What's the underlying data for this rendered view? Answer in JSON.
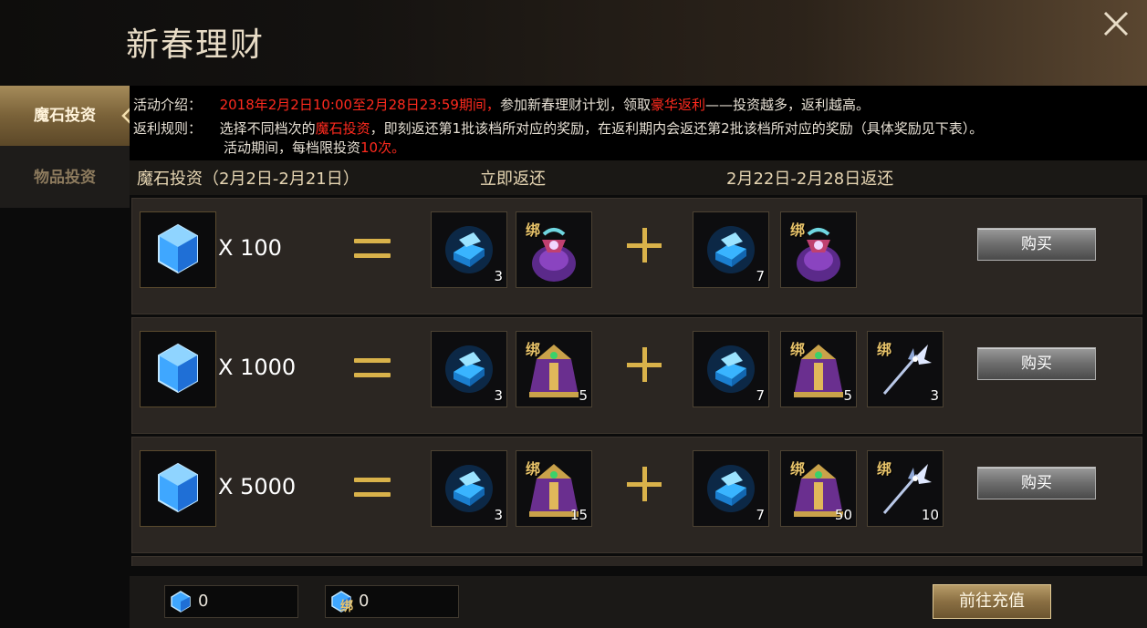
{
  "window": {
    "title": "新春理财"
  },
  "sidebar": {
    "items": [
      {
        "label": "魔石投资",
        "active": true
      },
      {
        "label": "物品投资",
        "active": false
      }
    ]
  },
  "info": {
    "intro_label": "活动介绍：",
    "intro_period": "2018年2月2日10:00至2月28日23:59期间，",
    "intro_text1": "参加新春理财计划，领取",
    "intro_highlight": "豪华返利",
    "intro_text2": "——投资越多，返利越高。",
    "rule_label": "返利规则：",
    "rule_text1": "选择不同档次的",
    "rule_highlight": "魔石投资",
    "rule_text2": "，即刻返还第1批该档所对应的奖励，在返利期内会返还第2批该档所对应的奖励（具体奖励见下表）。",
    "rule_line2_text": "活动期间，每档限投资",
    "rule_line2_highlight": "10次。"
  },
  "columns": {
    "invest": "魔石投资（2月2日-2月21日）",
    "immediate": "立即返还",
    "later": "2月22日-2月28日返还"
  },
  "rows": [
    {
      "amount": "X 100",
      "immediate": [
        {
          "icon": "blue-crystal-box",
          "count": "3",
          "bind": ""
        },
        {
          "icon": "purple-pouch",
          "count": "",
          "bind": "绑"
        }
      ],
      "later": [
        {
          "icon": "blue-crystal-box",
          "count": "7",
          "bind": ""
        },
        {
          "icon": "purple-pouch",
          "count": "",
          "bind": "绑"
        }
      ],
      "buy_label": "购买"
    },
    {
      "amount": "X 1000",
      "immediate": [
        {
          "icon": "blue-crystal-box",
          "count": "3",
          "bind": ""
        },
        {
          "icon": "ornate-chest",
          "count": "5",
          "bind": "绑"
        }
      ],
      "later": [
        {
          "icon": "blue-crystal-box",
          "count": "7",
          "bind": ""
        },
        {
          "icon": "ornate-chest",
          "count": "5",
          "bind": "绑"
        },
        {
          "icon": "ice-staff",
          "count": "3",
          "bind": "绑"
        }
      ],
      "buy_label": "购买"
    },
    {
      "amount": "X 5000",
      "immediate": [
        {
          "icon": "blue-crystal-box",
          "count": "3",
          "bind": ""
        },
        {
          "icon": "ornate-chest",
          "count": "15",
          "bind": "绑"
        }
      ],
      "later": [
        {
          "icon": "blue-crystal-box",
          "count": "7",
          "bind": ""
        },
        {
          "icon": "ornate-chest",
          "count": "50",
          "bind": "绑"
        },
        {
          "icon": "ice-staff",
          "count": "10",
          "bind": "绑"
        }
      ],
      "buy_label": "购买"
    }
  ],
  "footer": {
    "gem_balance": "0",
    "bound_gem_balance": "0",
    "bound_label": "绑",
    "recharge_label": "前往充值"
  },
  "icons": {
    "close": "close-icon",
    "gem": "blue-gem-icon"
  },
  "colors": {
    "highlight_red": "#ff2a1e",
    "accent_gold": "#d9b24a"
  }
}
